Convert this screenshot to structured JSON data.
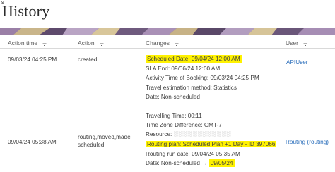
{
  "window": {
    "close_glyph": "×",
    "title": "History"
  },
  "table": {
    "headers": {
      "action_time": "Action time",
      "action": "Action",
      "changes": "Changes",
      "user": "User"
    },
    "rows": [
      {
        "time": "09/03/24 04:25 PM",
        "action": "created",
        "changes": [
          "Scheduled Date: 09/04/24 12:00 AM",
          "SLA End: 09/06/24 12:00 AM",
          "Activity Time of Booking: 09/03/24 04:25 PM",
          "Travel estimation method: Statistics",
          "Date: Non-scheduled"
        ],
        "user": "APIUser"
      },
      {
        "time": "09/04/24 05:38 AM",
        "action_line1": "routing,moved,made",
        "action_line2": "scheduled",
        "changes": [
          "Travelling Time: 00:11",
          "Time Zone Difference: GMT-7",
          "Resource:",
          "Routing plan: Scheduled Plan +1 Day - ID 397066",
          "Routing run date: 09/04/24 05:35 AM",
          "Date: Non-scheduled → ",
          "09/05/24"
        ],
        "user": "Routing (routing)"
      }
    ]
  },
  "colors": {
    "highlight": "#fff200",
    "link": "#2a6ebb"
  },
  "icons": {
    "filter": "filter-icon"
  }
}
